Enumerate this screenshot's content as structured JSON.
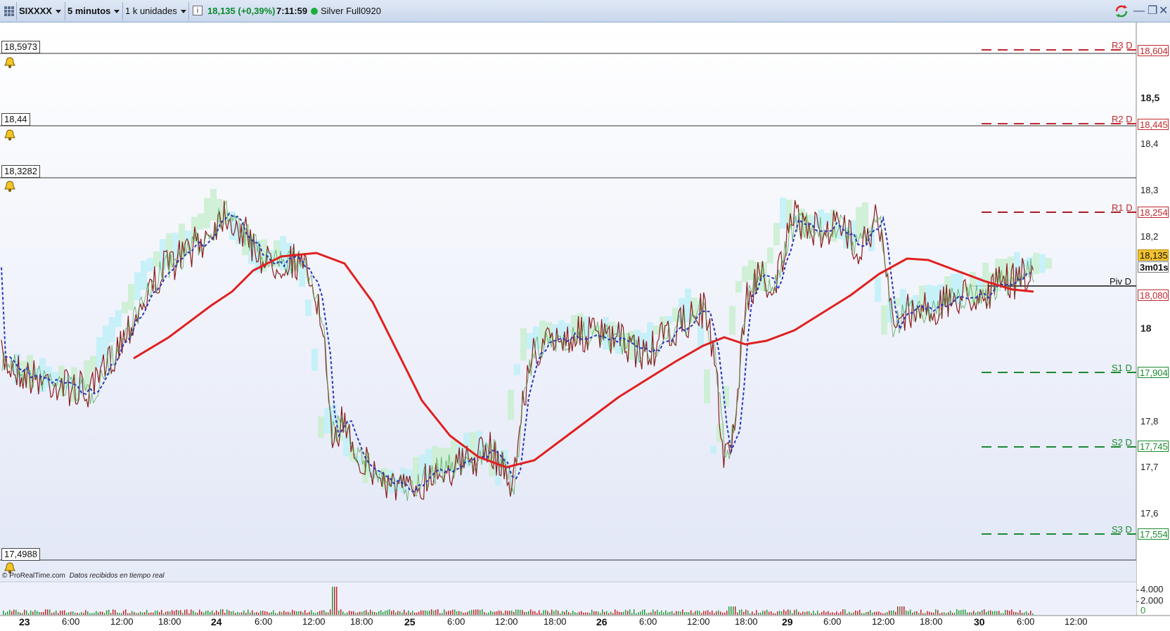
{
  "toolbar": {
    "symbol": "SIXXXX",
    "timeframe": "5 minutos",
    "units": "1 k unidades",
    "info": "i",
    "price_change": "18,135 (+0,39%)",
    "time": "7:11:59",
    "instrument": "Silver Full0920"
  },
  "levels": {
    "r3": {
      "name": "R3 D",
      "value": "18,604"
    },
    "r2": {
      "name": "R2 D",
      "value": "18,445"
    },
    "r1": {
      "name": "R1 D",
      "value": "18,254"
    },
    "piv": {
      "name": "Piv D"
    },
    "s1": {
      "name": "S1 D",
      "value": "17,904"
    },
    "s2": {
      "name": "S2 D",
      "value": "17,745"
    },
    "s3": {
      "name": "S3 D",
      "value": "17,554"
    }
  },
  "price_boxes": {
    "current": "18,135",
    "countdown": "3m01s",
    "low": "18,080"
  },
  "hlines": {
    "a": "18,5973",
    "b": "18,44",
    "c": "18,3282",
    "d": "17,4988"
  },
  "y_axis": [
    "18,5",
    "18,4",
    "18,3",
    "18,2",
    "18",
    "17,8",
    "17,7",
    "17,6"
  ],
  "volume_axis": [
    "4.000",
    "2.000",
    "0"
  ],
  "x_axis": [
    {
      "label": "23",
      "bold": true
    },
    {
      "label": "6:00"
    },
    {
      "label": "12:00"
    },
    {
      "label": "18:00"
    },
    {
      "label": "24",
      "bold": true
    },
    {
      "label": "6:00"
    },
    {
      "label": "12:00"
    },
    {
      "label": "18:00"
    },
    {
      "label": "25",
      "bold": true
    },
    {
      "label": "6:00"
    },
    {
      "label": "12:00"
    },
    {
      "label": "18:00"
    },
    {
      "label": "26",
      "bold": true
    },
    {
      "label": "6:00"
    },
    {
      "label": "12:00"
    },
    {
      "label": "18:00"
    },
    {
      "label": "29",
      "bold": true
    },
    {
      "label": "6:00"
    },
    {
      "label": "12:00"
    },
    {
      "label": "18:00"
    },
    {
      "label": "30",
      "bold": true
    },
    {
      "label": "6:00"
    },
    {
      "label": "12:00"
    }
  ],
  "footer": {
    "brand": "© ProRealTime.com",
    "note": "Datos recibidos en tiempo real"
  },
  "colors": {
    "resistance": "#c0282d",
    "support": "#1a8a2e",
    "ma": "#e02020",
    "price": "#8a1c1c"
  }
}
